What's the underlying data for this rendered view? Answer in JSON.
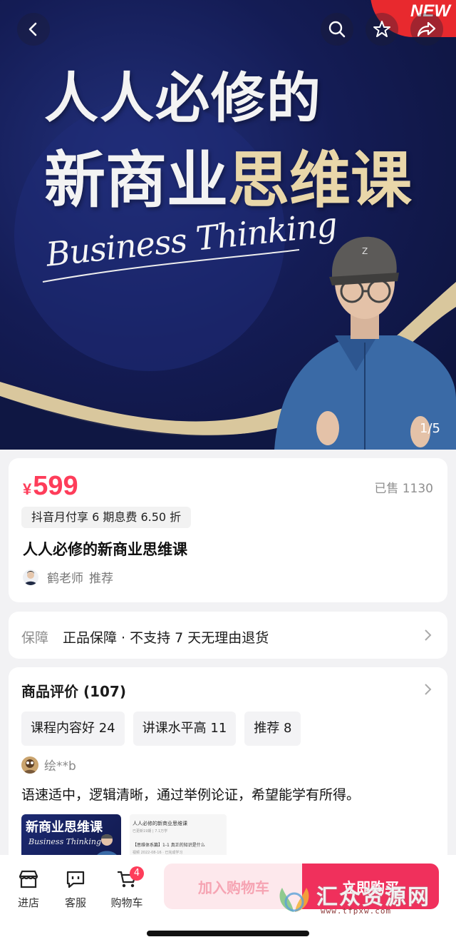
{
  "hero": {
    "title_line1": "人人必修的",
    "title_line2_white": "新商业",
    "title_line2_gold": "思维课",
    "script_text": "Business Thinking",
    "badge": "NEW",
    "counter": "1/5"
  },
  "top_icons": [
    "back-icon",
    "search-icon",
    "star-icon",
    "share-icon"
  ],
  "product": {
    "currency": "¥",
    "price": "599",
    "sold": "已售 1130",
    "installment": "抖音月付享 6 期息费 6.50 折",
    "title": "人人必修的新商业思维课",
    "recommender": "鹤老师",
    "recommend_label": "推荐"
  },
  "guarantee": {
    "label": "保障",
    "text": "正品保障 · 不支持 7 天无理由退货"
  },
  "reviews": {
    "title": "商品评价 (107)",
    "tags": [
      "课程内容好 24",
      "讲课水平高 11",
      "推荐 8"
    ],
    "reviewer": "绘**b",
    "text": "语速适中，逻辑清晰，通过举例论证，希望能学有所得。",
    "thumb1_title": "新商业思维课",
    "thumb1_script": "Business Thinking",
    "thumb2_lines": [
      "人人必修的新商业思维课",
      "已更新19期 | 7.1万学",
      "【思维体系篇】1-1 真正的知识是什么",
      "视频 2022-08-16 · 已完成学习"
    ]
  },
  "bottom_bar": {
    "store": "进店",
    "service": "客服",
    "cart": "购物车",
    "cart_count": "4",
    "add_to_cart": "加入购物车",
    "buy_now": "立即购买"
  },
  "watermark": {
    "text": "汇众资源网",
    "url": "www.tfpxw.com"
  },
  "colors": {
    "accent": "#fe3d5a",
    "buy_button": "#f0305c",
    "hero_bg": "#141c55",
    "gold": "#e9d7a9"
  }
}
